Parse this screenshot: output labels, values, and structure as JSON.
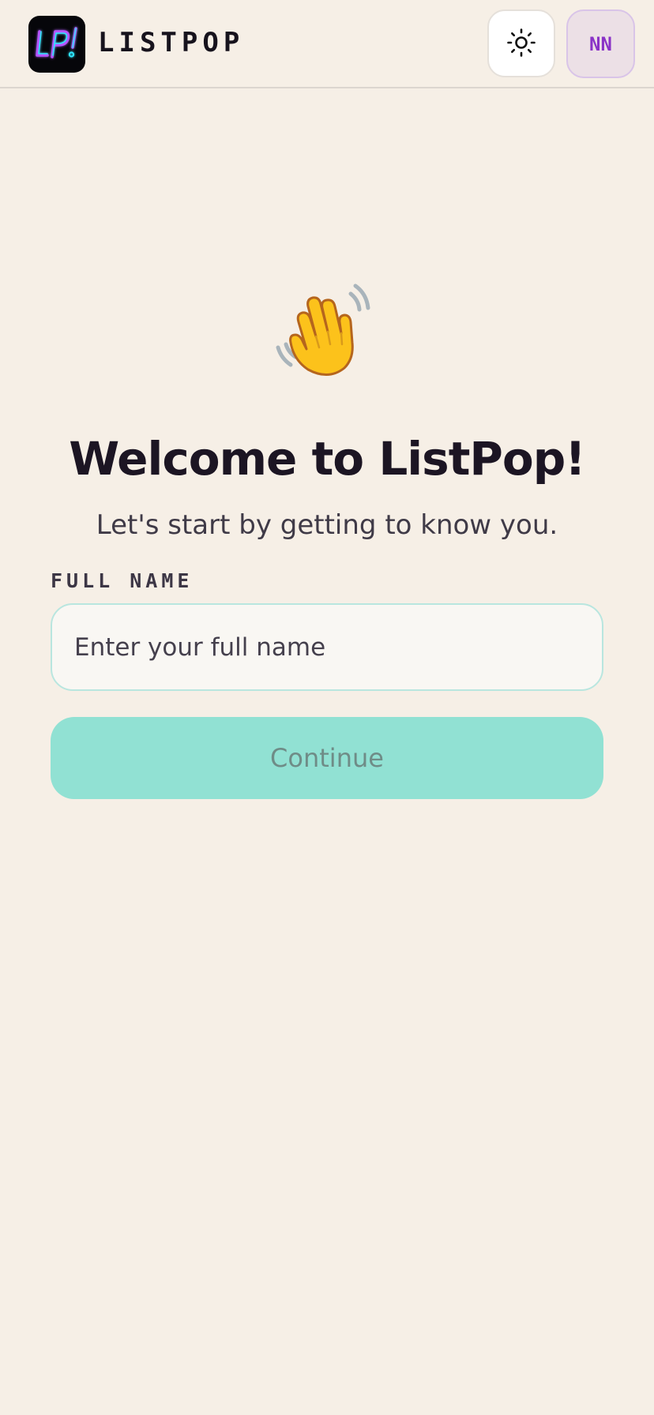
{
  "header": {
    "logo_icon": "listpop-neon-logo",
    "brand_name": "LISTPOP",
    "theme_toggle_icon": "sun-icon",
    "avatar_initials": "NN"
  },
  "main": {
    "hero_icon": "waving-hand-icon",
    "title": "Welcome to ListPop!",
    "subtitle": "Let's start by getting to know you.",
    "form": {
      "full_name_label": "FULL NAME",
      "full_name_value": "",
      "full_name_placeholder": "Enter your full name",
      "continue_label": "Continue"
    }
  },
  "colors": {
    "background": "#f6efe6",
    "accent": "#91e1d3",
    "avatar_text": "#8a33c7",
    "title_text": "#1c1523"
  }
}
